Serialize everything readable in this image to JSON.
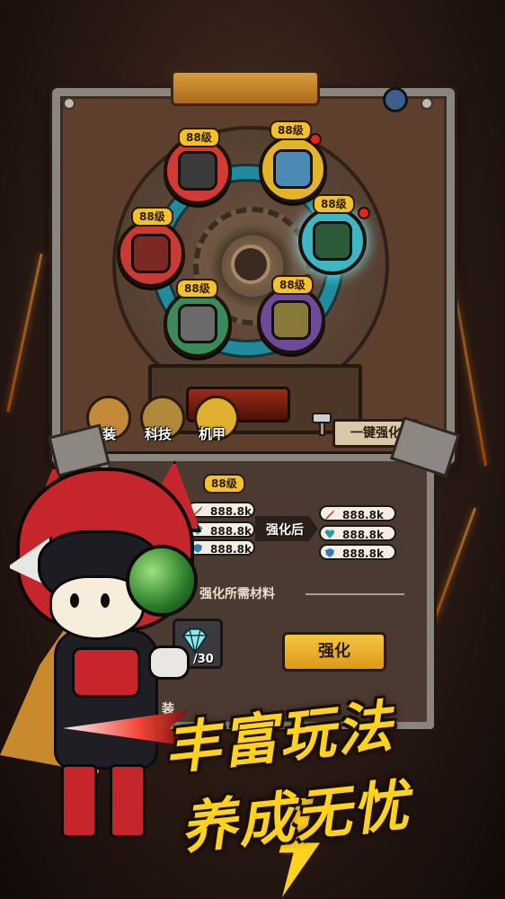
{
  "wheel": {
    "nodes": [
      {
        "level": "88级",
        "name": "red-cannon",
        "color": "#d23a34",
        "has_alert": false
      },
      {
        "level": "88级",
        "name": "shield-tower",
        "color": "#e3b428",
        "has_alert": true
      },
      {
        "level": "88级",
        "name": "green-orb-turret",
        "color": "#3fb6c4",
        "has_alert": true
      },
      {
        "level": "88级",
        "name": "purple-mech-claw",
        "color": "#6d4a9a",
        "has_alert": false
      },
      {
        "level": "88级",
        "name": "green-launcher",
        "color": "#3a8a5a",
        "has_alert": false
      },
      {
        "level": "88级",
        "name": "red-mortar",
        "color": "#c83a34",
        "has_alert": false
      }
    ]
  },
  "tabs": [
    {
      "label": "涂装"
    },
    {
      "label": "科技"
    },
    {
      "label": "机甲"
    }
  ],
  "upgrade_all_label": "一键强化",
  "detail": {
    "level": "88级",
    "before": [
      "888.8k",
      "888.8k",
      "888.8k"
    ],
    "after_label": "强化后",
    "after": [
      "888.8k",
      "888.8k",
      "888.8k"
    ],
    "materials_label": "强化所需材料",
    "material_count": "/30",
    "enhance_button": "强化",
    "partial_bottom": "装"
  },
  "slogan": {
    "line1": "丰富玩法",
    "line2": "养成无忧"
  },
  "colors": {
    "accent_gold": "#f3c12b",
    "frame_metal": "#8a857d",
    "ring_teal": "#1f8b9c",
    "slogan_yellow": "#ffd21f"
  }
}
